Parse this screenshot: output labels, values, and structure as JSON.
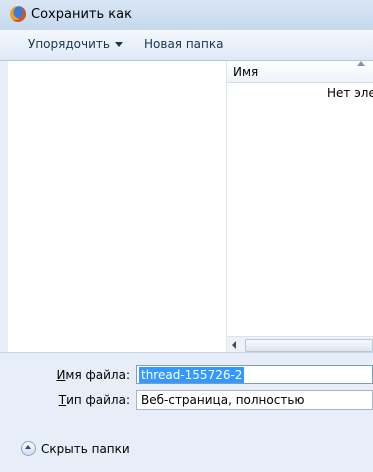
{
  "window": {
    "title": "Сохранить как",
    "icon": "firefox-icon"
  },
  "toolbar": {
    "organize_label": "Упорядочить",
    "new_folder_label": "Новая папка"
  },
  "list": {
    "column_name": "Имя",
    "empty_message": "Нет элем"
  },
  "form": {
    "filename_label_u": "И",
    "filename_label_rest": "мя файла:",
    "filename_value": "thread-155726-2",
    "filetype_label_u": "Т",
    "filetype_label_rest": "ип файла:",
    "filetype_value": "Веб-страница, полностью",
    "hide_folders_label": "Скрыть папки"
  }
}
